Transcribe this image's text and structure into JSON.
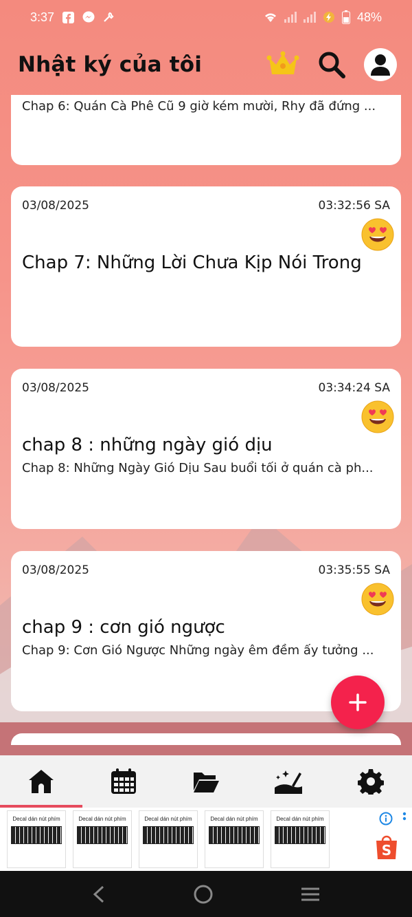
{
  "status_bar": {
    "time": "3:37",
    "battery": "48%",
    "left_icons": [
      "facebook-icon",
      "messenger-icon",
      "tools-icon"
    ],
    "right_icons": [
      "wifi-icon",
      "signal-icon",
      "signal-icon",
      "charging-icon",
      "battery-icon"
    ]
  },
  "header": {
    "title": "Nhật ký của tôi",
    "crown_color": "#f5c518"
  },
  "entries": [
    {
      "date": "",
      "time": "",
      "emoji": "",
      "title": "",
      "excerpt": "Chap 6: Quán Cà Phê Cũ 9 giờ kém mười, Rhy đã đứng ..."
    },
    {
      "date": "03/08/2025",
      "time": "03:32:56  SA",
      "emoji": "heart-eyes-emoji",
      "title": "Chap 7: Những Lời Chưa Kịp Nói Trong",
      "excerpt": ""
    },
    {
      "date": "03/08/2025",
      "time": "03:34:24  SA",
      "emoji": "heart-eyes-emoji",
      "title": "chap 8 : những ngày gió dịu",
      "excerpt": "Chap 8: Những Ngày Gió Dịu Sau buổi tối ở quán cà ph..."
    },
    {
      "date": "03/08/2025",
      "time": "03:35:55  SA",
      "emoji": "heart-eyes-emoji",
      "title": "chap 9 : cơn gió ngược",
      "excerpt": "Chap 9: Cơn Gió Ngược Những ngày êm đềm ấy tưởng ..."
    }
  ],
  "fab": {
    "icon": "plus-icon",
    "color": "#f4224c"
  },
  "bottom_nav": {
    "items": [
      {
        "icon": "home-icon",
        "active": true
      },
      {
        "icon": "calendar-icon",
        "active": false
      },
      {
        "icon": "folder-icon",
        "active": false
      },
      {
        "icon": "magic-theme-icon",
        "active": false
      },
      {
        "icon": "settings-icon",
        "active": false
      }
    ],
    "indicator_color": "#e64b5d"
  },
  "ad": {
    "items": [
      {
        "title": "Decal dán nút phím"
      },
      {
        "title": "Decal dán nút phím"
      },
      {
        "title": "Decal dán nút phím"
      },
      {
        "title": "Decal dán nút phím"
      },
      {
        "title": "Decal dán nút phím"
      }
    ]
  },
  "system_nav": [
    "back-icon",
    "home-circle-icon",
    "recents-icon"
  ]
}
